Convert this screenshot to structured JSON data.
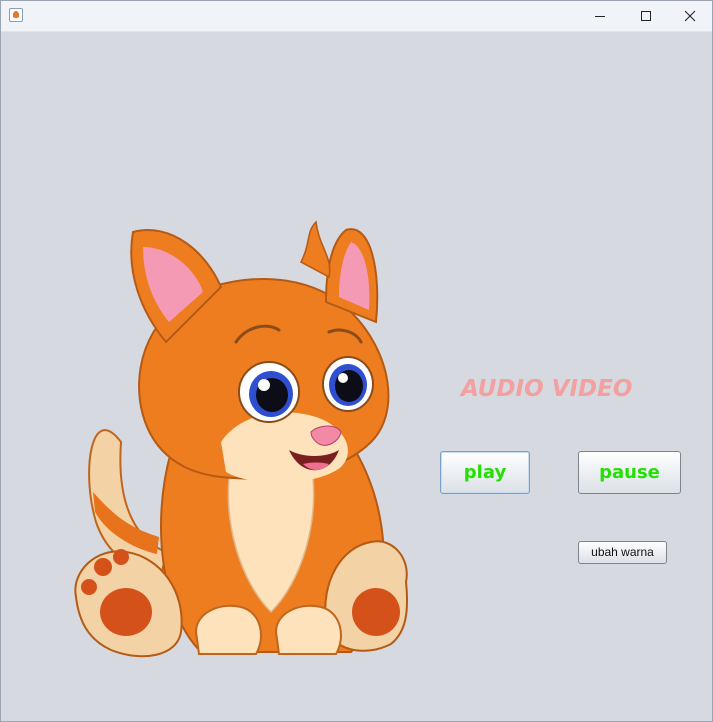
{
  "window": {
    "title": "",
    "app_icon": "java-icon",
    "controls": [
      "minimize-icon",
      "maximize-icon",
      "close-icon"
    ]
  },
  "main": {
    "heading": "AUDIO VIDEO",
    "image": "cartoon-orange-kitten",
    "buttons": {
      "play_label": "play",
      "pause_label": "pause",
      "change_color_label": "ubah warna"
    }
  },
  "colors": {
    "background": "#d6d9e0",
    "heading": "#f2a0a0",
    "button_text": "#22e000"
  }
}
